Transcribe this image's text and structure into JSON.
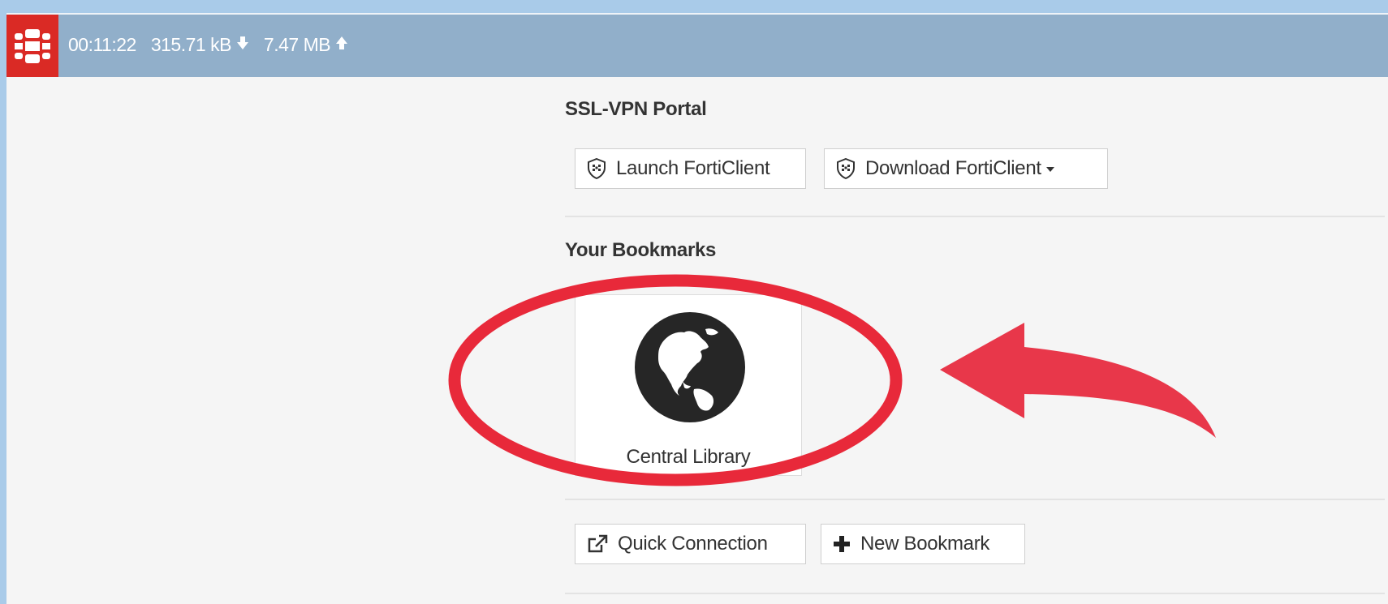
{
  "status_bar": {
    "session_time": "00:11:22",
    "downloaded": "315.71 kB",
    "uploaded": "7.47 MB"
  },
  "portal": {
    "title": "SSL-VPN Portal",
    "launch_label": "Launch FortiClient",
    "download_label": "Download FortiClient"
  },
  "bookmarks": {
    "title": "Your Bookmarks",
    "items": [
      {
        "label": "Central Library",
        "icon": "globe-icon"
      }
    ]
  },
  "actions": {
    "quick_connection_label": "Quick Connection",
    "new_bookmark_label": "New Bookmark"
  },
  "colors": {
    "page_frame": "#a9cbe9",
    "top_bar": "#91afca",
    "logo_bg": "#da2a25",
    "annotation_red": "#e8293a",
    "arrow_red": "#e8374a"
  }
}
